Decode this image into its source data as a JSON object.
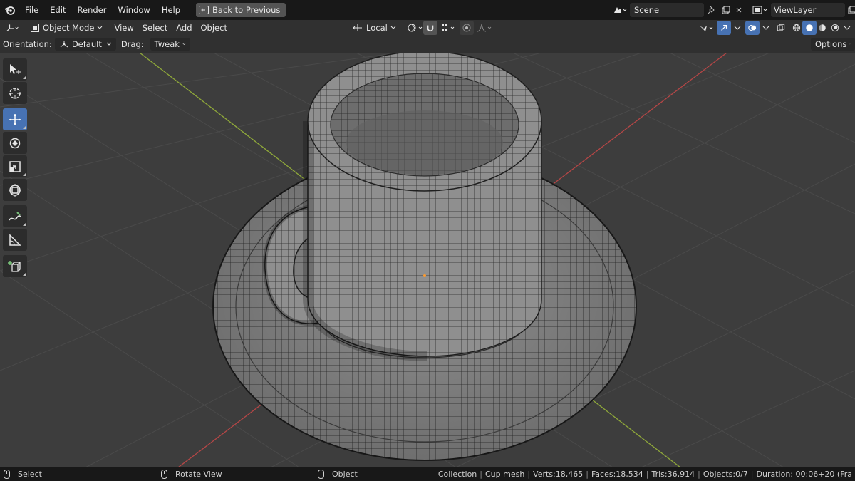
{
  "menu": {
    "items": [
      "File",
      "Edit",
      "Render",
      "Window",
      "Help"
    ],
    "back_label": "Back to Previous"
  },
  "scene": {
    "name": "Scene",
    "view_layer": "ViewLayer"
  },
  "header": {
    "mode": "Object Mode",
    "menus": [
      "View",
      "Select",
      "Add",
      "Object"
    ],
    "transform_orientation": "Local"
  },
  "tool_settings": {
    "orientation_label": "Orientation:",
    "orientation_value": "Default",
    "drag_label": "Drag:",
    "drag_value": "Tweak",
    "options_label": "Options"
  },
  "tools": [
    {
      "name": "select-box-tool",
      "icon": "select-box-icon",
      "active": false
    },
    {
      "name": "cursor-tool",
      "icon": "cursor-icon",
      "active": false
    },
    {
      "name": "move-tool",
      "icon": "move-icon",
      "active": true
    },
    {
      "name": "rotate-tool",
      "icon": "rotate-icon",
      "active": false
    },
    {
      "name": "scale-tool",
      "icon": "scale-icon",
      "active": false
    },
    {
      "name": "transform-tool",
      "icon": "transform-icon",
      "active": false
    },
    {
      "name": "annotate-tool",
      "icon": "annotate-icon",
      "active": false
    },
    {
      "name": "measure-tool",
      "icon": "measure-icon",
      "active": false
    },
    {
      "name": "add-cube-tool",
      "icon": "add-cube-icon",
      "active": false
    }
  ],
  "status": {
    "select": "Select",
    "rotate_view": "Rotate View",
    "object": "Object",
    "collection": "Collection",
    "object_name": "Cup mesh",
    "verts": "Verts:18,465",
    "faces": "Faces:18,534",
    "tris": "Tris:36,914",
    "objects": "Objects:0/7",
    "duration": "Duration: 00:06+20 (Fra"
  },
  "colors": {
    "accent": "#4772b3",
    "x_axis": "#b54646",
    "y_axis": "#8fa83a",
    "viewport_bg": "#3d3d3d",
    "mesh": "#8e8e8e"
  }
}
